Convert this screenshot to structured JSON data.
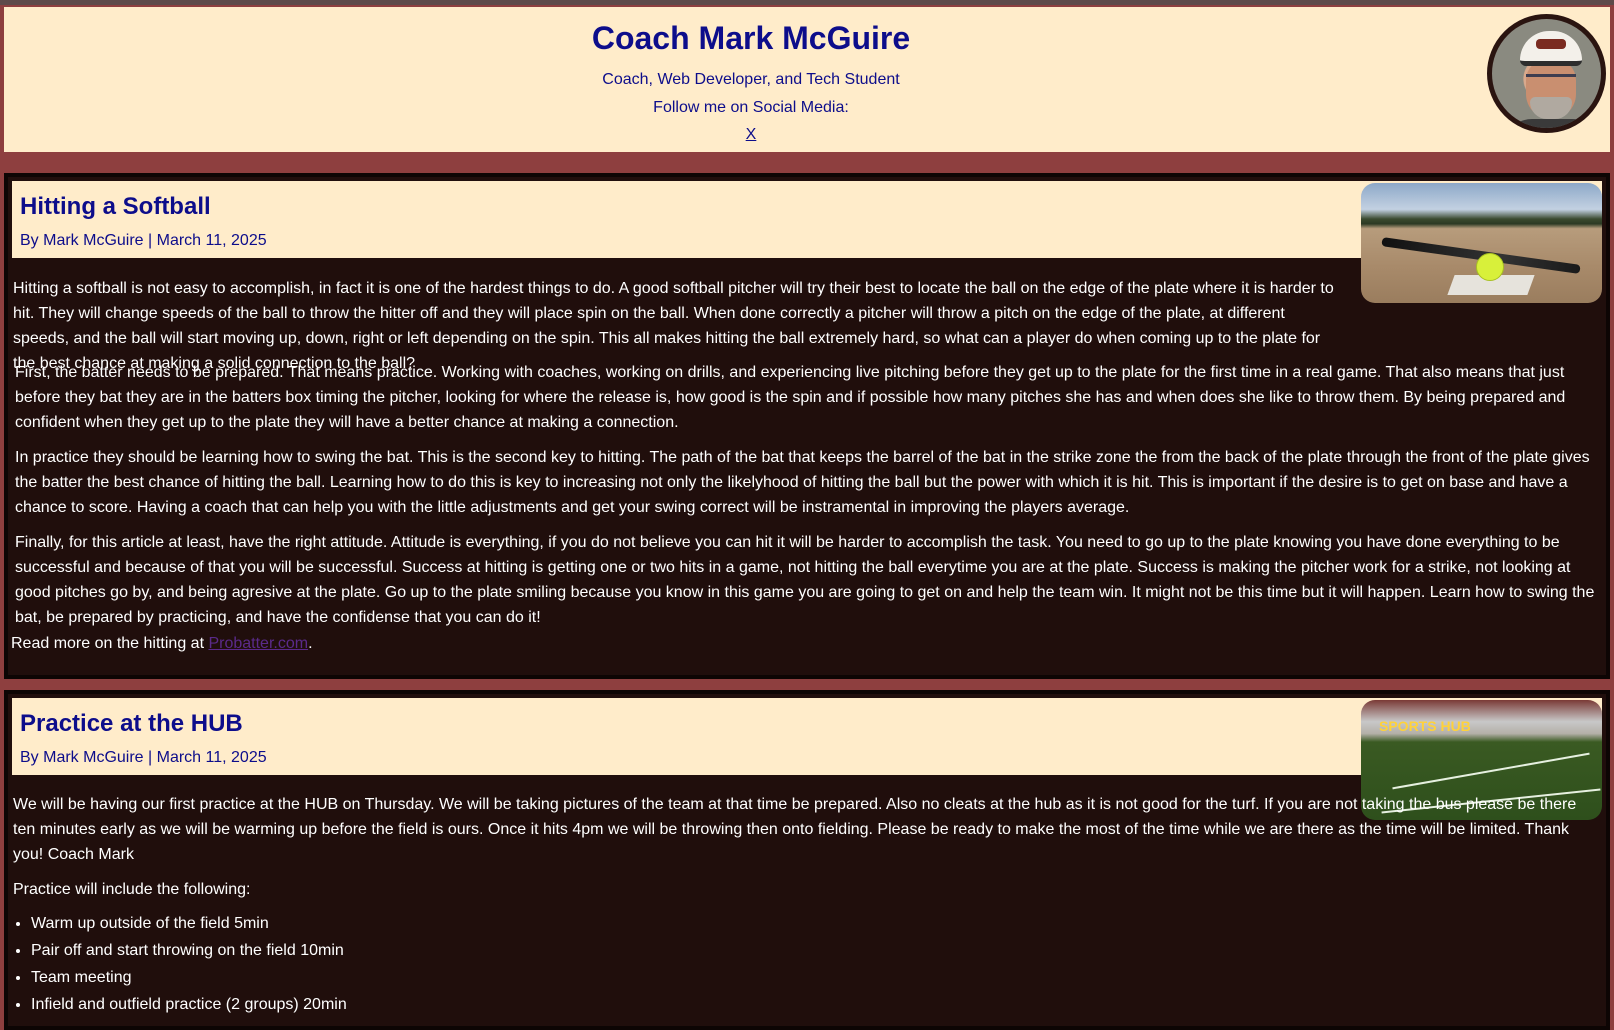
{
  "header": {
    "title": "Coach Mark McGuire",
    "subtitle": "Coach, Web Developer, and Tech Student",
    "follow_text": "Follow me on Social Media:",
    "social_link": "X"
  },
  "articles": [
    {
      "title": "Hitting a Softball",
      "meta": "By Mark McGuire | March 11, 2025",
      "paragraphs": [
        "Hitting a softball is not easy to accomplish, in fact it is one of the hardest things to do. A good softball pitcher will try their best to locate the ball on the edge of the plate where it is harder to hit. They will change speeds of the ball to throw the hitter off and they will place spin on the ball. When done correctly a pitcher will throw a pitch on the edge of the plate, at different speeds, and the ball will start moving up, down, right or left depending on the spin. This all makes hitting the ball extremely hard, so what can a player do when coming up to the plate for the best chance at making a solid connection to the ball?",
        "First, the batter needs to be prepared. That means practice. Working with coaches, working on drills, and experiencing live pitching before they get up to the plate for the first time in a real game. That also means that just before they bat they are in the batters box timing the pitcher, looking for where the release is, how good is the spin and if possible how many pitches she has and when does she like to throw them. By being prepared and confident when they get up to the plate they will have a better chance at making a connection.",
        "In practice they should be learning how to swing the bat. This is the second key to hitting. The path of the bat that keeps the barrel of the bat in the strike zone the from the back of the plate through the front of the plate gives the batter the best chance of hitting the ball. Learning how to do this is key to increasing not only the likelyhood of hitting the ball but the power with which it is hit. This is important if the desire is to get on base and have a chance to score. Having a coach that can help you with the little adjustments and get your swing correct will be instramental in improving the players average.",
        "Finally, for this article at least, have the right attitude. Attitude is everything, if you do not believe you can hit it will be harder to accomplish the task. You need to go up to the plate knowing you have done everything to be successful and because of that you will be successful. Success at hitting is getting one or two hits in a game, not hitting the ball everytime you are at the plate. Success is making the pitcher work for a strike, not looking at good pitches go by, and being agresive at the plate. Go up to the plate smiling because you know in this game you are going to get on and help the team win. It might not be this time but it will happen. Learn how to swing the bat, be prepared by practicing, and have the confidense that you can do it!"
      ],
      "read_more_prefix": "Read more on the hitting at",
      "read_more_link": "Probatter.com",
      "read_more_suffix": "."
    },
    {
      "title": "Practice at the HUB",
      "meta": "By Mark McGuire | March 11, 2025",
      "paragraphs": [
        "We will be having our first practice at the HUB on Thursday. We will be taking pictures of the team at that time be prepared. Also no cleats at the hub as it is not good for the turf. If you are not taking the bus please be there ten minutes early as we will be warming up before the field is ours. Once it hits 4pm we will be throwing then onto fielding. Please be ready to make the most of the time while we are there as the time will be limited. Thank you! Coach Mark",
        "Practice will include the following:"
      ],
      "list": [
        "Warm up outside of the field 5min",
        "Pair off and start throwing on the field 10min",
        "Team meeting",
        "Infield and outfield practice (2 groups) 20min"
      ],
      "image_sign": "SPORTS HUB"
    }
  ]
}
